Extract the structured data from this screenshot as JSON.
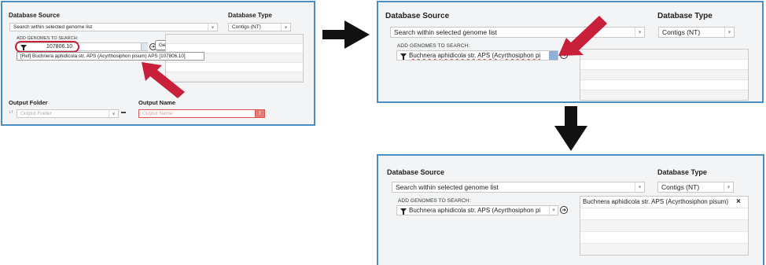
{
  "colors": {
    "panel_border": "#4a8fc4",
    "highlight_red": "#c8203a",
    "required_border": "#d9534f"
  },
  "panel1": {
    "database_source_label": "Database Source",
    "database_source_value": "Search within selected genome list",
    "database_type_label": "Database Type",
    "database_type_value": "Contigs (NT)",
    "add_genomes_label": "ADD GENOMES TO SEARCH:",
    "genome_search_value": "107806.10",
    "tooltip_text": "Genome name.",
    "dropdown_option": "[Ref] Buchnera aphidicola str. APS (Acyrthosiphon pisum) APS [107806.10]",
    "output_folder_label": "Output Folder",
    "output_folder_placeholder": "Output Folder",
    "output_name_label": "Output Name",
    "output_name_placeholder": "Output Name",
    "sort_icon_glyph": "↓↑",
    "folder_icon_glyph": "▬",
    "required_glyph": "!"
  },
  "panel2": {
    "database_source_label": "Database Source",
    "database_source_value": "Search within selected genome list",
    "database_type_label": "Database Type",
    "database_type_value": "Contigs (NT)",
    "add_genomes_label": "ADD GENOMES TO SEARCH:",
    "genome_search_value": "Buchnera aphidicola str. APS (Acyrthosiphon pi"
  },
  "panel3": {
    "database_source_label": "Database Source",
    "database_source_value": "Search within selected genome list",
    "database_type_label": "Database Type",
    "database_type_value": "Contigs (NT)",
    "add_genomes_label": "ADD GENOMES TO SEARCH:",
    "genome_search_value": "Buchnera aphidicola str. APS (Acyrthosiphon pi",
    "selected_genomes": [
      "Buchnera aphidicola str. APS (Acyrthosiphon pisum)"
    ],
    "remove_glyph": "×"
  },
  "add_button_glyph": "➜",
  "caret_glyph": "▾"
}
